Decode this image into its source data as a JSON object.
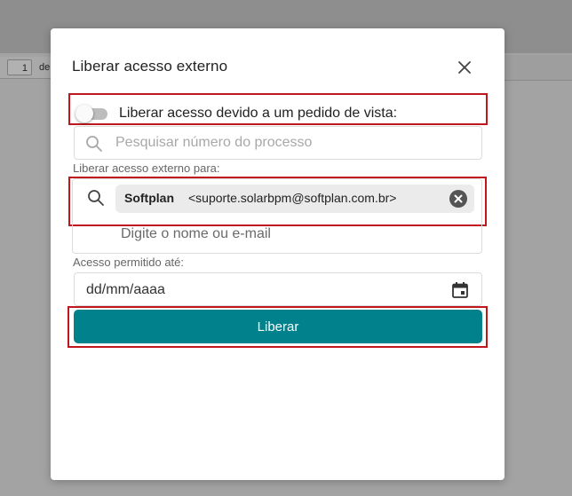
{
  "background": {
    "pager": {
      "page_number": "1",
      "trailing_text": "de"
    }
  },
  "modal": {
    "title": "Liberar acesso externo",
    "close_icon": "close-icon",
    "toggle": {
      "label": "Liberar acesso devido a um pedido de vista:",
      "checked": false
    },
    "process_search": {
      "placeholder": "Pesquisar número do processo",
      "value": "",
      "icon": "search-icon"
    },
    "recipients": {
      "label": "Liberar acesso externo para:",
      "icon": "search-icon",
      "chips": [
        {
          "name": "Softplan",
          "email": "<suporte.solarbpm@softplan.com.br>",
          "remove_icon": "remove-circle-icon"
        }
      ],
      "input_placeholder": "Digite o nome ou e-mail"
    },
    "access_until": {
      "label": "Acesso permitido até:",
      "value": "dd/mm/aaaa",
      "icon": "calendar-icon"
    },
    "submit_label": "Liberar"
  },
  "colors": {
    "primary": "#00818b",
    "highlight": "#c0161d",
    "overlay": "#9a9a9a"
  }
}
